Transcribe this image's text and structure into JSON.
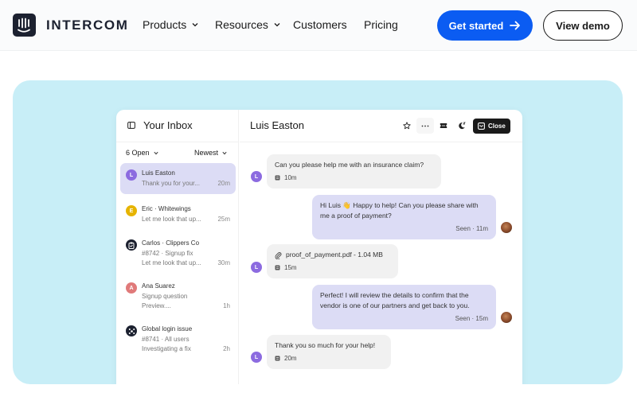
{
  "header": {
    "brand": "INTERCOM",
    "nav": [
      {
        "label": "Products",
        "has_dropdown": true
      },
      {
        "label": "Resources",
        "has_dropdown": true
      },
      {
        "label": "Customers",
        "has_dropdown": false
      },
      {
        "label": "Pricing",
        "has_dropdown": false
      }
    ],
    "cta_primary": "Get started",
    "cta_secondary": "View demo",
    "colors": {
      "primary": "#0b5cf2",
      "brand_dark": "#1c2130",
      "hero_bg": "#c8eef7"
    }
  },
  "inbox": {
    "title": "Your Inbox",
    "filter_status": "6 Open",
    "filter_sort": "Newest",
    "conversations": [
      {
        "avatar": "L",
        "avatar_color": "#8c6be0",
        "name": "Luis Easton",
        "lines": [
          "Thank you for your..."
        ],
        "time": "20m",
        "active": true
      },
      {
        "avatar": "E",
        "avatar_color": "#e6b400",
        "name": "Eric · Whitewings",
        "lines": [
          "Let me look that up..."
        ],
        "time": "25m",
        "active": false
      },
      {
        "avatar": "clipboard-icon",
        "avatar_color": "#1c2130",
        "name": "Carlos · Clippers Co",
        "lines": [
          "#8742  · Signup fix",
          "Let me look that up..."
        ],
        "time": "30m",
        "active": false
      },
      {
        "avatar": "A",
        "avatar_color": "#e07a7a",
        "name": "Ana Suarez",
        "lines": [
          "Signup question",
          "Preview...."
        ],
        "time": "1h",
        "active": false
      },
      {
        "avatar": "network-icon",
        "avatar_color": "#1c2130",
        "name": "Global login issue",
        "lines": [
          "#8741 · All users",
          "Investigating a fix"
        ],
        "time": "2h",
        "active": false
      }
    ]
  },
  "chat": {
    "contact_name": "Luis Easton",
    "close_label": "Close",
    "messages": [
      {
        "direction": "in",
        "text": "Can you please help me with an insurance claim?",
        "meta": "10m"
      },
      {
        "direction": "out",
        "text": "Hi Luis 👋 Happy to help! Can you please share with me a proof of payment?",
        "meta": "Seen · 11m"
      },
      {
        "direction": "in",
        "text": "proof_of_payment.pdf - 1.04 MB",
        "meta": "15m",
        "attachment": true
      },
      {
        "direction": "out",
        "text": "Perfect! I will review the details to confirm that the vendor is one of our partners and get back to you.",
        "meta": "Seen · 15m"
      },
      {
        "direction": "in",
        "text": "Thank you so much for your help!",
        "meta": "20m"
      }
    ],
    "user_avatar_letter": "L"
  }
}
